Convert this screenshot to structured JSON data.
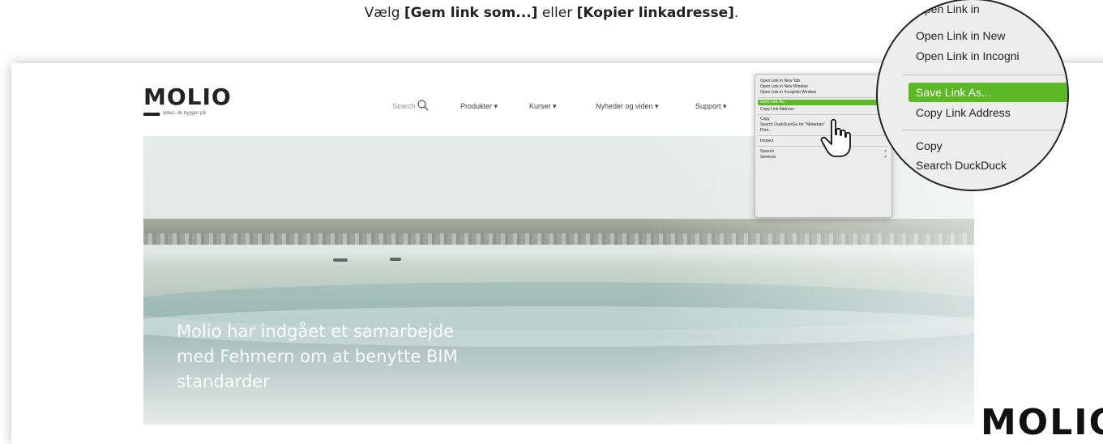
{
  "instruction": {
    "prefix": "Vælg ",
    "option1": "[Gem link som...]",
    "middle": " eller ",
    "option2": "[Kopier linkadresse]",
    "suffix": "."
  },
  "site": {
    "logo": "MOLIO",
    "tagline": "viden, du bygger på",
    "nav": {
      "search": "Search",
      "items": [
        "Produkter ▾",
        "Kurser ▾",
        "Nyheder og viden ▾",
        "Support ▾"
      ]
    },
    "hero_text": "Molio har indgået et samarbejde med Fehmern om at benytte BIM standarder"
  },
  "context_menu": {
    "items": [
      "Open Link in New Tab",
      "Open Link in New Window",
      "Open Link in Incognito Window",
      "Save Link As...",
      "Copy Link Address",
      "Copy",
      "Search DuckDuckGo for \"Metadata\"",
      "Print...",
      "Inspect",
      "Speech",
      "Services"
    ],
    "highlighted": "Save Link As...",
    "submenu_arrow": ">"
  },
  "zoom": {
    "items": [
      "Open Link in",
      "Open Link in New",
      "Open Link in Incogni",
      "Save Link As...",
      "Copy Link Address",
      "Copy",
      "Search DuckDuck"
    ]
  },
  "corner_logo": "MOLIO",
  "colors": {
    "highlight": "#5cb827",
    "menu_bg": "#ececec",
    "text": "#222222"
  }
}
